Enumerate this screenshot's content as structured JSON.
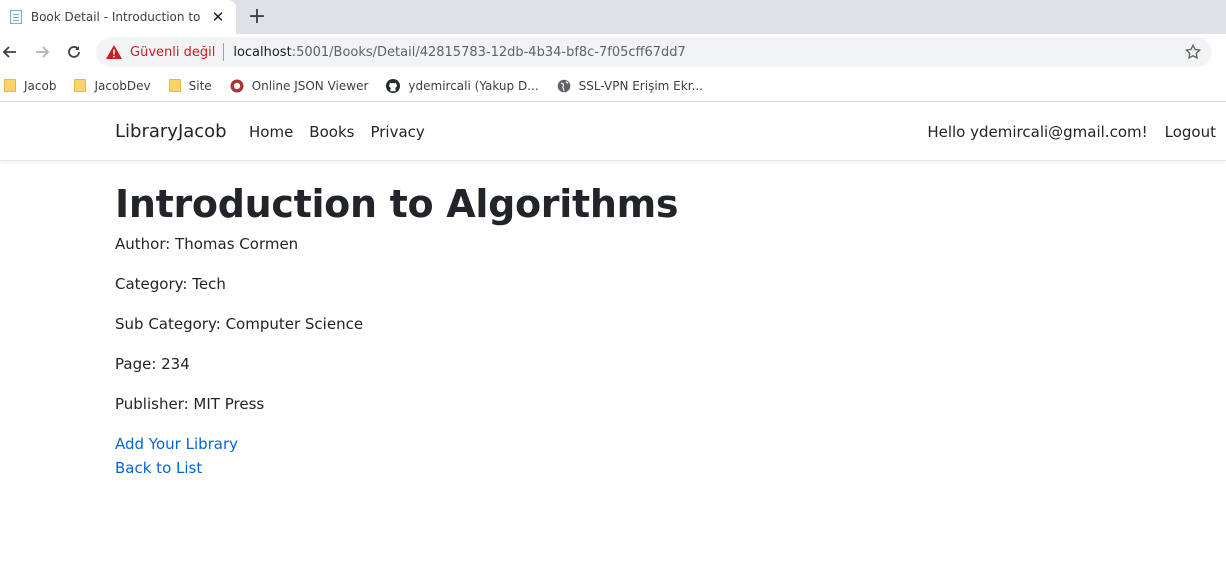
{
  "browser": {
    "tab": {
      "title": "Book Detail - Introduction to Alg",
      "close": "✕"
    },
    "new_tab": "+",
    "security_label": "Güvenli değil",
    "url_host": "localhost",
    "url_rest": ":5001/Books/Detail/42815783-12db-4b34-bf8c-7f05cff67dd7",
    "bookmarks": [
      {
        "label": "Jacob",
        "icon": "folder-icon"
      },
      {
        "label": "JacobDev",
        "icon": "folder-icon"
      },
      {
        "label": "Site",
        "icon": "folder-icon"
      },
      {
        "label": "Online JSON Viewer",
        "icon": "json-viewer-icon"
      },
      {
        "label": "ydemircali (Yakup D...",
        "icon": "github-icon"
      },
      {
        "label": "SSL-VPN Erişim Ekr...",
        "icon": "globe-icon"
      }
    ]
  },
  "site": {
    "brand": "LibraryJacob",
    "nav": [
      "Home",
      "Books",
      "Privacy"
    ],
    "hello": "Hello ydemircali@gmail.com!",
    "logout": "Logout"
  },
  "book": {
    "title": "Introduction to Algorithms",
    "author": "Author: Thomas Cormen",
    "category": "Category: Tech",
    "sub_category": "Sub Category: Computer Science",
    "page": "Page: 234",
    "publisher": "Publisher: MIT Press"
  },
  "actions": {
    "add": "Add Your Library",
    "back": "Back to List"
  },
  "colors": {
    "link": "#0366d6",
    "warning": "#c5221f",
    "text": "#212529"
  }
}
